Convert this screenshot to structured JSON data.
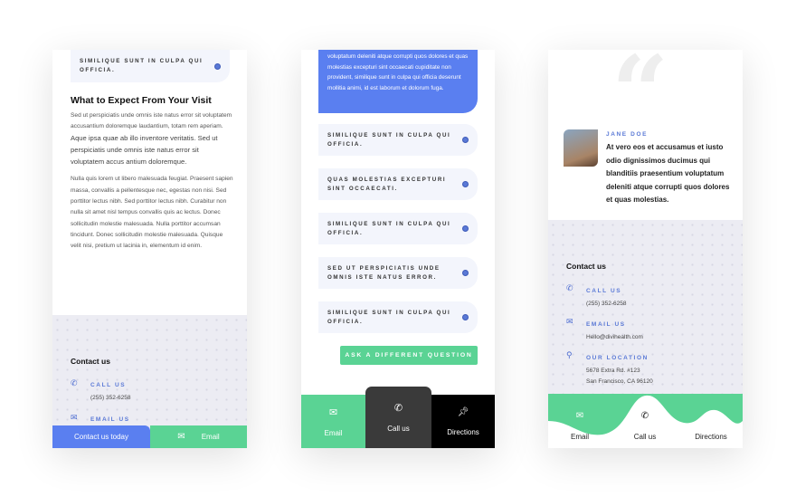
{
  "panel1": {
    "faq_top": "SIMILIQUE SUNT IN CULPA QUI OFFICIA.",
    "heading": "What to Expect From Your Visit",
    "para1_small": "Sed ut perspiciatis unde omnis iste natus error sit voluptatem accusantium doloremque laudantium, totam rem aperiam.",
    "para1_large": "Aque ipsa quae ab illo inventore veritatis. Sed ut perspiciatis unde omnis iste natus error sit voluptatem accus antium doloremque.",
    "para2": "Nulla quis lorem ut libero malesuada feugiat. Praesent sapien massa, convallis a pellentesque nec, egestas non nisi. Sed porttitor lectus nibh. Sed porttitor lectus nibh. Curabitur non nulla sit amet nisl tempus convallis quis ac lectus. Donec sollicitudin molestie malesuada. Nulla porttitor accumsan tincidunt. Donec sollicitudin molestie malesuada. Quisque velit nisi, pretium ut lacinia in, elementum id enim.",
    "contact_title": "Contact us",
    "call_label": "CALL US",
    "phone": "(255) 352-6258",
    "email_label": "EMAIL US",
    "bar_primary": "Contact us today",
    "bar_secondary": "Email"
  },
  "panel2": {
    "answer": "voluptatum deleniti atque corrupti quos dolores et quas molestias excepturi sint occaecati cupiditate non provident, similique sunt in culpa qui officia deserunt mollitia animi, id est laborum et dolorum fuga.",
    "faqs": [
      "SIMILIQUE SUNT IN CULPA QUI OFFICIA.",
      "QUAS MOLESTIAS EXCEPTURI SINT OCCAECATI.",
      "SIMILIQUE SUNT IN CULPA QUI OFFICIA.",
      "SED UT PERSPICIATIS UNDE OMNIS ISTE NATUS ERROR.",
      "SIMILIQUE SUNT IN CULPA QUI OFFICIA."
    ],
    "ask_button": "ASK A DIFFERENT QUESTION",
    "tabs": [
      "Email",
      "Call us",
      "Directions"
    ]
  },
  "panel3": {
    "name": "JANE DOE",
    "quote": "At vero eos et accusamus et iusto odio dignissimos ducimus qui blanditiis praesentium voluptatum deleniti atque corrupti quos dolores et quas molestias.",
    "contact_title": "Contact us",
    "call_label": "CALL US",
    "phone": "(255) 352-6258",
    "email_label": "EMAIL US",
    "email": "Hello@divihealth.com",
    "location_label": "OUR LOCATION",
    "address1": "5678 Extra Rd. #123",
    "address2": "San Francisco, CA 96120",
    "tabs": [
      "Email",
      "Call us",
      "Directions"
    ]
  },
  "colors": {
    "blue": "#5a7ff0",
    "green": "#5ad394",
    "dark": "#3a3a3a",
    "black": "#000000"
  }
}
